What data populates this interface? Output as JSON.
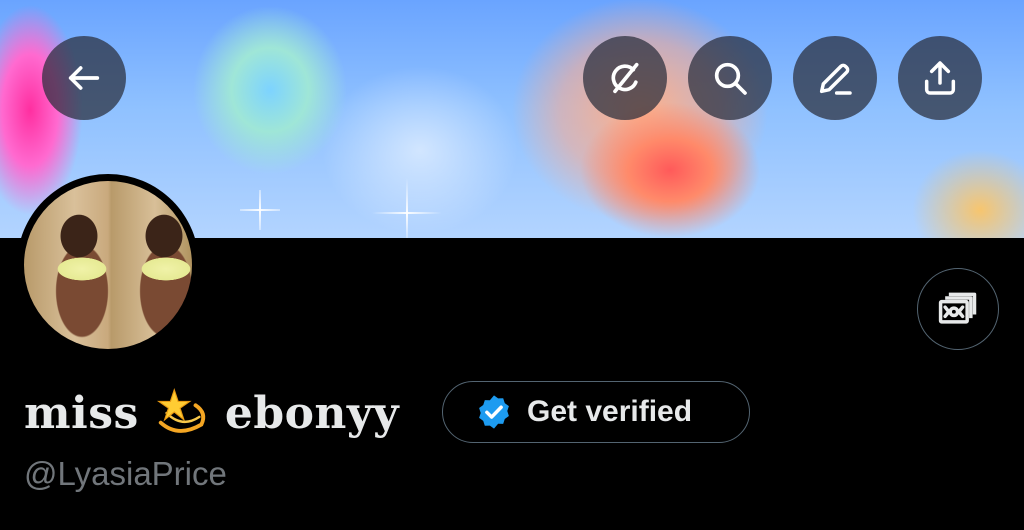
{
  "header": {
    "buttons": [
      {
        "name": "back-button",
        "icon": "arrow-left-icon"
      },
      {
        "name": "grok-button",
        "icon": "grok-slash-icon"
      },
      {
        "name": "search-button",
        "icon": "search-icon"
      },
      {
        "name": "edit-button",
        "icon": "pencil-icon"
      },
      {
        "name": "share-button",
        "icon": "share-icon"
      }
    ]
  },
  "profile": {
    "display_name_part1": "miss",
    "display_name_emoji": "dizzy-star-emoji",
    "display_name_part2": "ebonyy",
    "handle": "@LyasiaPrice",
    "verify_label": "Get verified",
    "tip_icon": "money-icon"
  },
  "colors": {
    "background": "#000000",
    "text_primary": "#e7e9ea",
    "text_secondary": "#71767b",
    "border": "#536471",
    "verified_blue": "#1d9bf0"
  }
}
